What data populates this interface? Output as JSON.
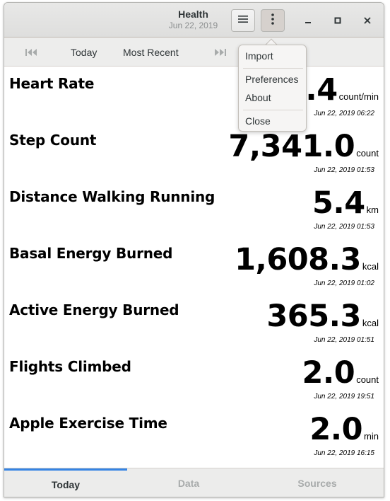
{
  "window": {
    "title": "Health",
    "subtitle": "Jun 22, 2019"
  },
  "headerbar": {
    "list_icon": "hamburger-list-icon",
    "menu_icon": "vertical-dots-icon",
    "minimize_icon": "minimize-icon",
    "maximize_icon": "maximize-icon",
    "close_icon": "close-icon"
  },
  "toolbar": {
    "first_icon": "skip-first-icon",
    "today_label": "Today",
    "recent_label": "Most Recent",
    "last_icon": "skip-last-icon"
  },
  "metrics": [
    {
      "name": "Heart Rate",
      "value": "101.4",
      "unit": "count/min",
      "date": "Jun 22, 2019 06:22"
    },
    {
      "name": "Step Count",
      "value": "7,341.0",
      "unit": "count",
      "date": "Jun 22, 2019 01:53"
    },
    {
      "name": "Distance Walking Running",
      "value": "5.4",
      "unit": "km",
      "date": "Jun 22, 2019 01:53"
    },
    {
      "name": "Basal Energy Burned",
      "value": "1,608.3",
      "unit": "kcal",
      "date": "Jun 22, 2019 01:02"
    },
    {
      "name": "Active Energy Burned",
      "value": "365.3",
      "unit": "kcal",
      "date": "Jun 22, 2019 01:51"
    },
    {
      "name": "Flights Climbed",
      "value": "2.0",
      "unit": "count",
      "date": "Jun 22, 2019 19:51"
    },
    {
      "name": "Apple Exercise Time",
      "value": "2.0",
      "unit": "min",
      "date": "Jun 22, 2019 16:15"
    }
  ],
  "tabs": [
    {
      "label": "Today",
      "active": true
    },
    {
      "label": "Data",
      "active": false
    },
    {
      "label": "Sources",
      "active": false
    }
  ],
  "menu": {
    "items": [
      "Import",
      "Preferences",
      "About",
      "Close"
    ]
  },
  "colors": {
    "accent": "#3584e4",
    "headerbar": "#e8e8e7",
    "text": "#2e3436"
  }
}
